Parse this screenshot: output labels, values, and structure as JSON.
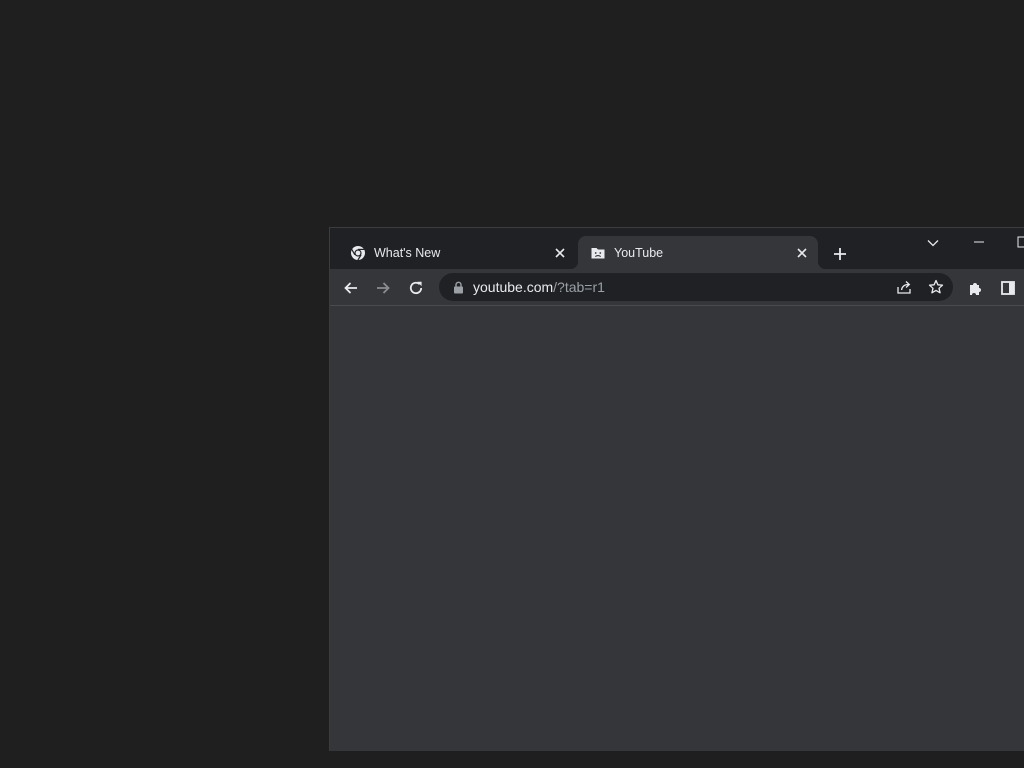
{
  "tabs": [
    {
      "title": "What's New",
      "favicon": "chrome-icon",
      "active": false
    },
    {
      "title": "YouTube",
      "favicon": "sad-folder-icon",
      "active": true
    }
  ],
  "omnibox": {
    "host": "youtube.com",
    "path": "/?tab=r1"
  },
  "colors": {
    "desktop": "#1f1f1f",
    "frame": "#202124",
    "toolbar": "#35363a",
    "text": "#e8eaed",
    "muted": "#9aa0a6"
  }
}
